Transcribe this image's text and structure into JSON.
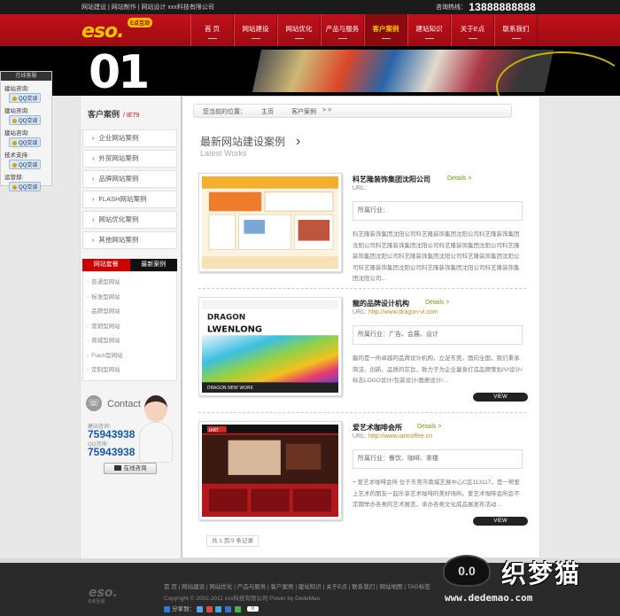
{
  "topbar": {
    "links": "网站建设 | 网站制作 | 网站设计  xxx科技有限公司",
    "hotline_label": "咨询热线：",
    "hotline_number": "13888888888"
  },
  "logo": {
    "mark": "eso.",
    "tag": "E点互动"
  },
  "nav": [
    {
      "label": "首 页",
      "active": false
    },
    {
      "label": "网站建设",
      "active": false
    },
    {
      "label": "网站优化",
      "active": false
    },
    {
      "label": "产品与服务",
      "active": false
    },
    {
      "label": "客户案例",
      "active": true
    },
    {
      "label": "建站知识",
      "active": false
    },
    {
      "label": "关于E点",
      "active": false
    },
    {
      "label": "联系我们",
      "active": false
    }
  ],
  "banner": {
    "big_text": "01"
  },
  "float_service": {
    "title": "在线客服",
    "rows": [
      {
        "label": "建站咨询:",
        "qq": "QQ交谈"
      },
      {
        "label": "建站咨询:",
        "qq": "QQ交谈"
      },
      {
        "label": "建站咨询:",
        "qq": "QQ交谈"
      },
      {
        "label": "技术支持:",
        "qq": "QQ交谈"
      },
      {
        "label": "运营部:",
        "qq": "QQ交谈"
      }
    ]
  },
  "sidebar": {
    "title": "客户案例",
    "subtitle": "/ IE79",
    "categories": [
      "企业网站案例",
      "外贸网站案例",
      "品牌网站案例",
      "FLASH网站案例",
      "网站优化案例",
      "其他网站案例"
    ],
    "tab_active": "网站套餐",
    "tab_other": "最新案例",
    "types": [
      "普通型网站",
      "标准型网站",
      "品牌型网站",
      "营销型网站",
      "商城型网站",
      "Flash型网站",
      "定制型网站"
    ]
  },
  "contact": {
    "title": "Contact",
    "label1": "建站咨询：",
    "number1": "75943938",
    "label2": "QQ咨询：",
    "number2": "75943938",
    "button": "在线咨询"
  },
  "breadcrumb": {
    "location_label": "您当前的位置：",
    "home": "主页",
    "current": "客户案例",
    "arrows": "> >"
  },
  "page": {
    "title": "最新网站建设案例",
    "subtitle": "Latest Works"
  },
  "cases": [
    {
      "name": "科艺隆装饰集团沈阳公司",
      "details": "Details >",
      "url_label": "URL:",
      "url": "",
      "industry": "所属行业：",
      "desc": "科艺隆装饰集团沈阳公司科艺隆装饰集团沈阳公司科艺隆装饰集团沈阳公司科艺隆装饰集团沈阳公司科艺隆装饰集团沈阳公司科艺隆装饰集团沈阳公司科艺隆装饰集团沈阳公司科艺隆装饰集团沈阳公司科艺隆装饰集团沈阳公司科艺隆装饰集团沈阳公司科艺隆装饰集团沈阳公司...",
      "view": ""
    },
    {
      "name": "龍的品牌设计机构",
      "details": "Details >",
      "url_label": "URL:",
      "url": "http://www.dragon-vi.com",
      "industry": "所属行业：广告、会展、设计",
      "desc": "龍的是一所卓越的品牌设计机构，立足东莞，面向全国，我们秉承简洁、创新、品质的宗旨，致力于为企业量身打造品牌策划/VI设计/标志LOGO设计/包装设计/画册设计/...",
      "view": "VIEW"
    },
    {
      "name": "爱艺术咖啡会所",
      "details": "Details >",
      "url_label": "URL:",
      "url": "http://www.iartcoffee.cn",
      "industry": "所属行业：餐饮、咖啡、茶楼",
      "desc": "+ 爱艺术咖啡会所 位于东莞市南城艺展中心C区113117，是一帮爱上艺术的朋友一起乐享艺术咖啡的美好场所。爱艺术咖啡会所会不定期举办各类的艺术展览，承办各类文化成品展发布活动...",
      "view": "VIEW"
    }
  ],
  "pager": "共 1 页/3 条记录",
  "footer": {
    "logo": "eso.",
    "logo_caption": "E点互动",
    "links": "首 页 | 网站建设 | 网站优化 | 产品与服务 | 客户案例 | 建站知识 | 关于E点 | 联系我们 | 网站地图 | TAG标签",
    "copyright": "Copyright © 2002-2011 xxx科技有限公司 Power by DedeMao",
    "share_label": "分享到：",
    "share_count": "0"
  },
  "watermark": {
    "brand": "织梦猫",
    "site": "www.dedemao.com",
    "face": "0.0"
  },
  "colors": {
    "brand_red": "#c1111b",
    "nav_active": "#f5c400",
    "link_green": "#6a9a1a",
    "phone_blue": "#1558a8"
  }
}
